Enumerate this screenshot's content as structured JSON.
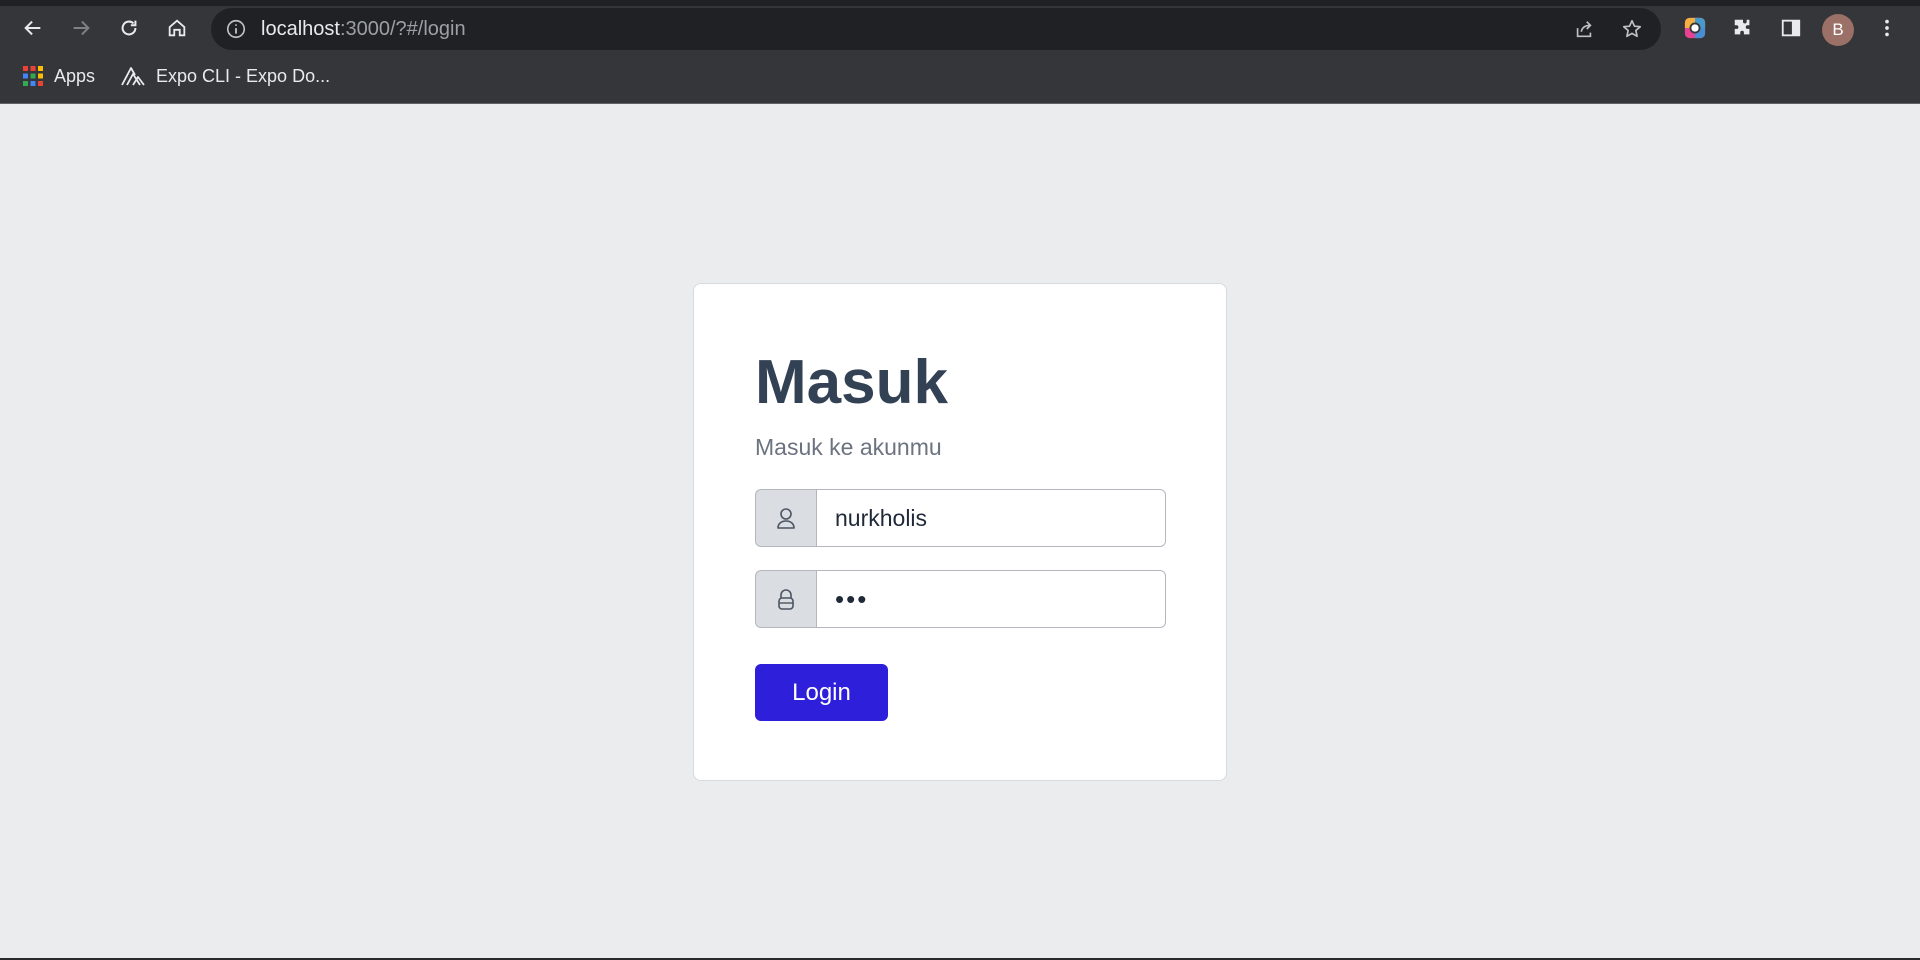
{
  "browser": {
    "url_host": "localhost",
    "url_rest": ":3000/?#/login",
    "profile_initial": "B",
    "bookmarks": [
      {
        "label": "Apps"
      },
      {
        "label": "Expo CLI - Expo Do..."
      }
    ]
  },
  "login": {
    "title": "Masuk",
    "subtitle": "Masuk ke akunmu",
    "username_value": "nurkholis",
    "password_value": "•••",
    "submit_label": "Login"
  },
  "colors": {
    "page_bg": "#ebecee",
    "title": "#334155",
    "button": "#2e1fdb",
    "chrome_bg": "#35363a"
  }
}
